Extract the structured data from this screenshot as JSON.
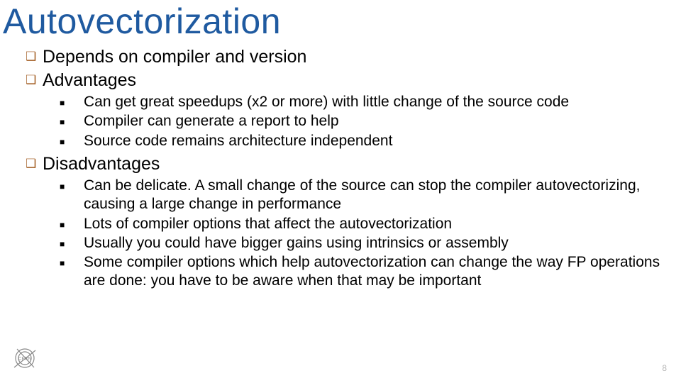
{
  "title": "Autovectorization",
  "bullets": {
    "b0": "Depends on compiler and version",
    "b1": "Advantages",
    "b1_sub": {
      "s0": "Can get great speedups (x2 or more) with little change of the source code",
      "s1": "Compiler can generate a report to help",
      "s2": "Source code remains architecture independent"
    },
    "b2": "Disadvantages",
    "b2_sub": {
      "s0": "Can be delicate. A small change of the source can stop the compiler autovectorizing, causing a large change in performance",
      "s1": "Lots of compiler options that affect the autovectorization",
      "s2": "Usually you could have bigger gains using intrinsics or assembly",
      "s3": "Some compiler options which help autovectorization can change the way FP operations are done: you have to be aware when that may be important"
    }
  },
  "logo_label": "CERN",
  "page_number": "8"
}
